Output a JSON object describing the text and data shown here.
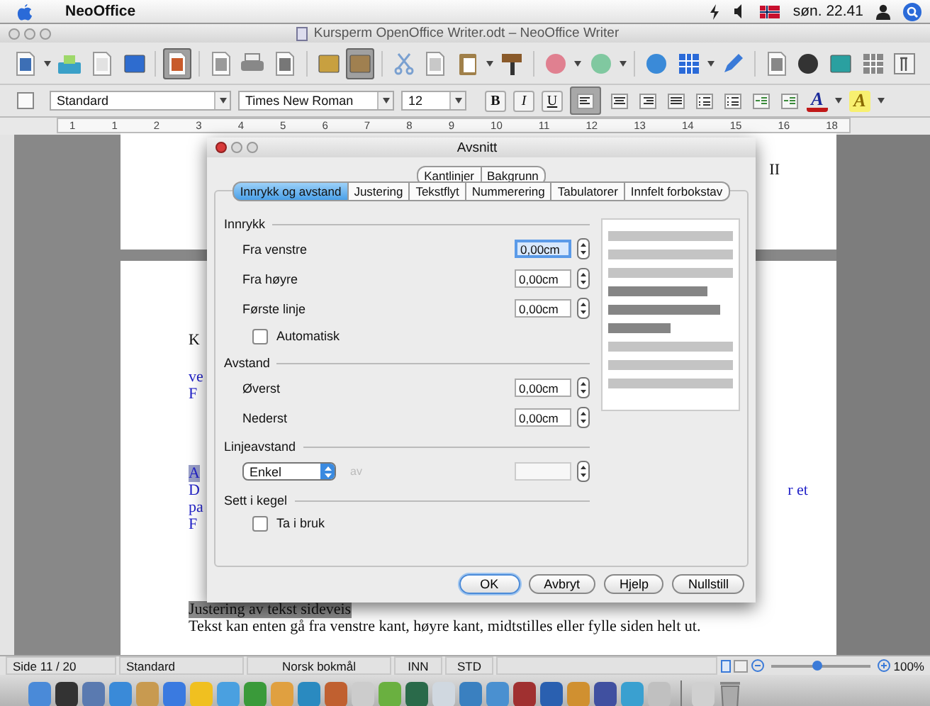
{
  "menubar": {
    "app": "NeoOffice",
    "clock": "søn. 22.41"
  },
  "window": {
    "title": "Kursperm OpenOffice Writer.odt – NeoOffice Writer"
  },
  "toolbar": [
    {
      "kind": "doc",
      "pressed": false
    },
    {
      "kind": "caret",
      "pressed": false
    },
    {
      "kind": "folder",
      "pressed": false
    },
    {
      "kind": "blank",
      "pressed": false
    },
    {
      "kind": "save",
      "pressed": false
    },
    {
      "kind": "sep"
    },
    {
      "kind": "edit",
      "pressed": true
    },
    {
      "kind": "sep"
    },
    {
      "kind": "pdf",
      "pressed": false
    },
    {
      "kind": "print",
      "pressed": false
    },
    {
      "kind": "preview",
      "pressed": false
    },
    {
      "kind": "sep"
    },
    {
      "kind": "frame",
      "pressed": false
    },
    {
      "kind": "frame2",
      "pressed": true
    },
    {
      "kind": "sep"
    },
    {
      "kind": "cut",
      "pressed": false
    },
    {
      "kind": "copy",
      "pressed": false
    },
    {
      "kind": "paste",
      "pressed": false
    },
    {
      "kind": "caret",
      "pressed": false
    },
    {
      "kind": "brush",
      "pressed": false
    },
    {
      "kind": "sep"
    },
    {
      "kind": "undo",
      "pressed": false
    },
    {
      "kind": "caret",
      "pressed": false
    },
    {
      "kind": "redo",
      "pressed": false
    },
    {
      "kind": "caret",
      "pressed": false
    },
    {
      "kind": "sep"
    },
    {
      "kind": "globe",
      "pressed": false
    },
    {
      "kind": "table",
      "pressed": false
    },
    {
      "kind": "caret",
      "pressed": false
    },
    {
      "kind": "pencil",
      "pressed": false
    },
    {
      "kind": "sep"
    },
    {
      "kind": "find",
      "pressed": false
    },
    {
      "kind": "gallery",
      "pressed": false
    },
    {
      "kind": "picture",
      "pressed": false
    },
    {
      "kind": "fields",
      "pressed": false
    },
    {
      "kind": "pilcrow",
      "pressed": false
    }
  ],
  "format_toolbar": {
    "style": "Standard",
    "font": "Times New Roman",
    "size": "12",
    "buttons": [
      {
        "kind": "bold",
        "label": "B",
        "pressed": false
      },
      {
        "kind": "italic",
        "label": "I",
        "pressed": false
      },
      {
        "kind": "underline",
        "label": "U",
        "pressed": false
      },
      {
        "kind": "align-left",
        "pressed": true
      },
      {
        "kind": "align-center",
        "pressed": false
      },
      {
        "kind": "align-right",
        "pressed": false
      },
      {
        "kind": "justify",
        "pressed": false
      },
      {
        "kind": "numbering",
        "pressed": false
      },
      {
        "kind": "bullets",
        "pressed": false
      },
      {
        "kind": "outdent",
        "pressed": false
      },
      {
        "kind": "indent",
        "pressed": false
      },
      {
        "kind": "font-color",
        "label": "A",
        "pressed": false
      },
      {
        "kind": "highlight",
        "label": "A",
        "pressed": false
      }
    ]
  },
  "ruler": {
    "labels": [
      "1",
      "1",
      "2",
      "3",
      "4",
      "5",
      "6",
      "7",
      "8",
      "9",
      "10",
      "11",
      "12",
      "13",
      "14",
      "15",
      "16",
      "18"
    ]
  },
  "document": {
    "page1_fragment": "II",
    "blocks": [
      [
        {
          "kind": "plain",
          "text": "K"
        }
      ],
      [
        {
          "kind": "link",
          "text": "ve"
        },
        {
          "kind": "link",
          "text": "F"
        }
      ],
      [
        {
          "kind": "marked-link",
          "text": "A"
        },
        {
          "kind": "link",
          "text": "D",
          "right": "r et"
        },
        {
          "kind": "link",
          "text": "pa"
        },
        {
          "kind": "link",
          "text": "F"
        }
      ],
      [
        {
          "kind": "marked",
          "text": "Justering av tekst sideveis"
        },
        {
          "kind": "plain",
          "text": "Tekst kan enten gå fra venstre kant, høyre kant, midtstilles eller fylle siden helt ut."
        }
      ]
    ]
  },
  "dialog": {
    "title": "Avsnitt",
    "top_tabs": [
      {
        "label": "Kantlinjer",
        "selected": false
      },
      {
        "label": "Bakgrunn",
        "selected": false
      }
    ],
    "tabs": [
      {
        "label": "Innrykk og avstand",
        "selected": true
      },
      {
        "label": "Justering",
        "selected": false
      },
      {
        "label": "Tekstflyt",
        "selected": false
      },
      {
        "label": "Nummerering",
        "selected": false
      },
      {
        "label": "Tabulatorer",
        "selected": false
      },
      {
        "label": "Innfelt forbokstav",
        "selected": false
      }
    ],
    "sections": [
      {
        "heading": "Innrykk",
        "rows": [
          {
            "kind": "field",
            "label": "Fra venstre",
            "value": "0,00cm",
            "focused": true
          },
          {
            "kind": "field",
            "label": "Fra høyre",
            "value": "0,00cm",
            "focused": false
          },
          {
            "kind": "field",
            "label": "Første linje",
            "value": "0,00cm",
            "focused": false
          },
          {
            "kind": "checkbox",
            "label": "Automatisk",
            "checked": false
          }
        ]
      },
      {
        "heading": "Avstand",
        "rows": [
          {
            "kind": "field",
            "label": "Øverst",
            "value": "0,00cm",
            "focused": false
          },
          {
            "kind": "field",
            "label": "Nederst",
            "value": "0,00cm",
            "focused": false
          }
        ]
      },
      {
        "heading": "Linjeavstand",
        "rows": [
          {
            "kind": "select",
            "value": "Enkel",
            "label": "av",
            "disabled": true
          }
        ]
      },
      {
        "heading": "Sett i kegel",
        "rows": [
          {
            "kind": "checkbox",
            "label": "Ta i bruk",
            "checked": false
          }
        ]
      }
    ],
    "buttons": [
      {
        "label": "OK",
        "default": true
      },
      {
        "label": "Avbryt",
        "default": false
      },
      {
        "label": "Hjelp",
        "default": false
      },
      {
        "label": "Nullstill",
        "default": false
      }
    ]
  },
  "status_bar": {
    "page": "Side 11 / 20",
    "style": "Standard",
    "language": "Norsk bokmål",
    "insert_mode": "INN",
    "selection_mode": "STD",
    "zoom": {
      "level": 0.45
    },
    "zoom_percent": "100%"
  }
}
